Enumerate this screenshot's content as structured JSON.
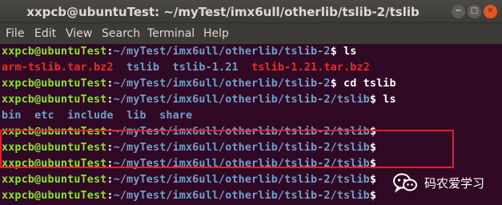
{
  "window": {
    "title": "xxpcb@ubuntuTest: ~/myTest/imx6ull/otherlib/tslib-2/tslib",
    "minimize_glyph": "−",
    "maximize_glyph": "□",
    "close_glyph": "✕"
  },
  "menu": {
    "file": "File",
    "edit": "Edit",
    "view": "View",
    "search": "Search",
    "terminal": "Terminal",
    "help": "Help"
  },
  "terminal": {
    "prompt_user": "xxpcb@ubuntuTest",
    "sep": ":",
    "dollar": "$",
    "lines": [
      {
        "path": "~/myTest/imx6ull/otherlib/tslib-2",
        "cmd": " ls"
      },
      {
        "items": [
          "arm-tslib.tar.bz2",
          "tslib",
          "tslib-1.21",
          "tslib-1.21.tar.bz2"
        ]
      },
      {
        "path": "~/myTest/imx6ull/otherlib/tslib-2",
        "cmd": " cd tslib"
      },
      {
        "path": "~/myTest/imx6ull/otherlib/tslib-2/tslib",
        "cmd": " ls"
      },
      {
        "items": [
          "bin",
          "etc",
          "include",
          "lib",
          "share"
        ]
      },
      {
        "path": "~/myTest/imx6ull/otherlib/tslib-2/tslib",
        "cmd": ""
      },
      {
        "path": "~/myTest/imx6ull/otherlib/tslib-2/tslib",
        "cmd": ""
      },
      {
        "path": "~/myTest/imx6ull/otherlib/tslib-2/tslib",
        "cmd": ""
      },
      {
        "path": "~/myTest/imx6ull/otherlib/tslib-2/tslib",
        "cmd": ""
      },
      {
        "path": "~/myTest/imx6ull/otherlib/tslib-2/tslib",
        "cmd": ""
      }
    ]
  },
  "watermark": {
    "text": "码农爱学习",
    "icon": "wechat-icon"
  },
  "colors": {
    "background": "#300a24",
    "prompt_user": "#8ae234",
    "prompt_path": "#729fcf",
    "archive_file": "#ef2929",
    "directory": "#729fcf",
    "highlight_box": "#e0202a"
  }
}
